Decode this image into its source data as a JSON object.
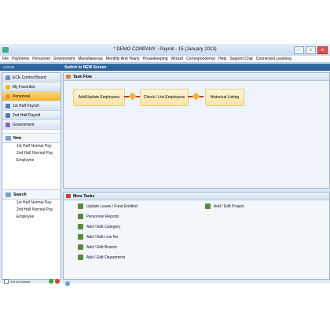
{
  "window": {
    "title": "* DEMO COMPANY - Payroll -    15 (January 2013)"
  },
  "menu": [
    "File",
    "Payments",
    "Personnel",
    "Government",
    "Miscellaneous",
    "Monthly And Yearly",
    "Housekeeping",
    "Wizard",
    "Correspondence",
    "Help",
    "Support Chat",
    "Connected Learning"
  ],
  "toolbar": {
    "login": "LOGIN",
    "switch": "Switch to NEW Screen"
  },
  "nav": [
    {
      "label": "ECE Control Board",
      "icon": "board-icon"
    },
    {
      "label": "My Favorites",
      "icon": "star-icon"
    },
    {
      "label": "Personnel",
      "icon": "personnel-icon"
    },
    {
      "label": "1st Half Payroll",
      "icon": "calendar-icon"
    },
    {
      "label": "2nd Half Payroll",
      "icon": "calendar-icon"
    },
    {
      "label": "Government",
      "icon": "government-icon"
    }
  ],
  "new_panel": {
    "title": "New",
    "items": [
      "1st Half Normal Pay",
      "2nd Half Normal Pay",
      "Employee"
    ]
  },
  "search_panel": {
    "title": "Search",
    "items": [
      "1st Half Normal Pay",
      "2nd Half Normal Pay",
      "Employee"
    ]
  },
  "bottom": {
    "checkbox_label": "Set As Default"
  },
  "task_flow": {
    "title": "Task Flow",
    "steps": [
      "Add/Update Employees",
      "Check / List Employees",
      "Historical Listing"
    ]
  },
  "more_tasks": {
    "title": "More Tasks",
    "left": [
      "Update Leave / Fund Entitled",
      "Personnel Reports",
      "Add / Edit Category",
      "Add / Edit Line No.",
      "Add / Edit Branch",
      "Add / Edit Department"
    ],
    "right": [
      "Add / Edit Project"
    ]
  },
  "colors": {
    "accent": "#3a6ea5",
    "active_nav": "#f5b429",
    "flow_step": "#f7e3a3",
    "flow_arrow": "#c0392b"
  }
}
